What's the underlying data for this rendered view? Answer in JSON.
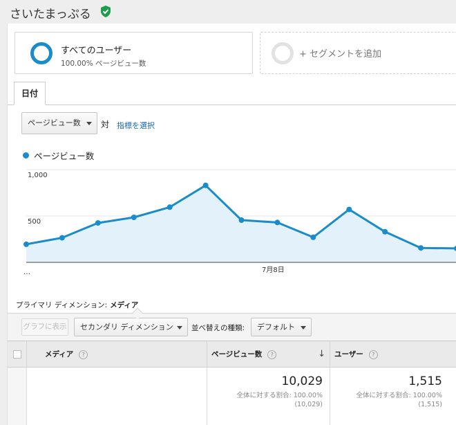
{
  "header": {
    "site_title": "さいたまっぷる"
  },
  "segments": [
    {
      "name": "すべてのユーザー",
      "sub": "100.00% ページビュー数"
    },
    {
      "name": "+ セグメントを追加"
    }
  ],
  "tabs": [
    {
      "label": "日付"
    }
  ],
  "metric_picker": {
    "selected": "ページビュー数",
    "vs": "対",
    "link": "指標を選択"
  },
  "legend": {
    "label": "ページビュー数",
    "color": "#1a8cc9"
  },
  "chart_data": {
    "type": "area",
    "series": [
      {
        "name": "ページビュー数",
        "values": [
          195,
          265,
          425,
          485,
          595,
          830,
          455,
          430,
          270,
          570,
          330,
          155,
          150
        ]
      }
    ],
    "x_tick_labels": [
      "…",
      "7月8日"
    ],
    "y_tick_labels": [
      "1,000",
      "500"
    ],
    "ylim": [
      0,
      1000
    ],
    "color": "#1a8cc9",
    "fill": "#e3f2fa"
  },
  "primary_dimension": {
    "label": "プライマリ ディメンション:",
    "value": "メディア"
  },
  "toolbar": {
    "graph_button": "グラフに表示",
    "secondary_dimension": "セカンダリ ディメンション",
    "sort_label": "並べ替えの種類:",
    "sort_value": "デフォルト"
  },
  "table": {
    "columns": [
      "メディア",
      "ページビュー数",
      "ユーザー"
    ],
    "totals": {
      "pageviews": "10,029",
      "pageviews_pct_label": "全体に対する割合: 100.00%",
      "pageviews_pct_sub": "(10,029)",
      "users": "1,515",
      "users_pct_label": "全体に対する割合: 100.00%",
      "users_pct_sub": "(1,515)"
    }
  }
}
